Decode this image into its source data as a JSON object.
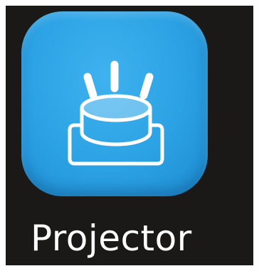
{
  "app": {
    "label": "Projector",
    "icon": "projector-icon",
    "accent_color": "#2ba2e4",
    "background_color": "#1a1918",
    "label_color": "#ffffff"
  }
}
